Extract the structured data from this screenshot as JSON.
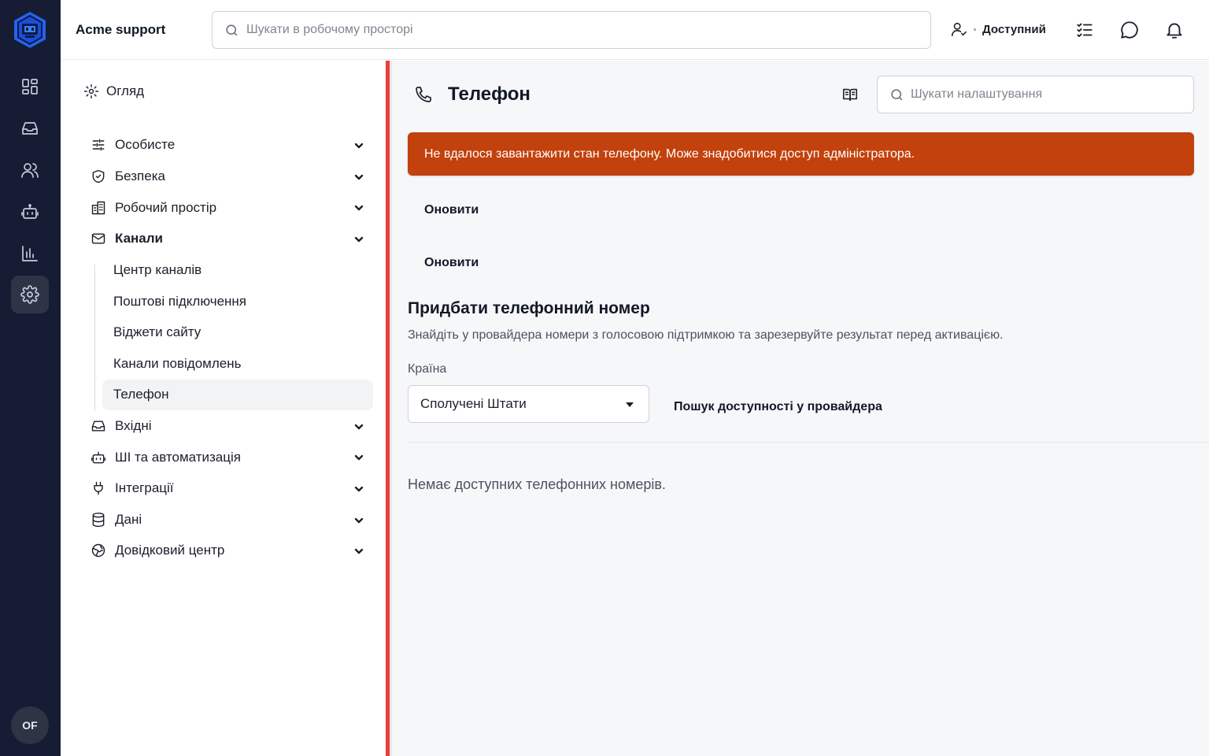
{
  "app": {
    "brand": "Acme support",
    "user_initials": "OF",
    "accent_color": "#2563eb",
    "alert_color": "#c2410c",
    "highlight_color": "#ef3b3b"
  },
  "topbar": {
    "search_placeholder": "Шукати в робочому просторі",
    "status_label": "Доступний",
    "icons": [
      "user-icon",
      "checklist-icon",
      "chat-icon",
      "bell-icon"
    ]
  },
  "rail": {
    "icons": [
      "dashboard-icon",
      "inbox-icon",
      "users-icon",
      "bot-icon",
      "analytics-icon",
      "settings-icon"
    ],
    "active": "settings-icon"
  },
  "nav": {
    "overview": "Огляд",
    "groups": [
      {
        "label": "Особисте",
        "icon": "sliders-icon"
      },
      {
        "label": "Безпека",
        "icon": "shield-icon"
      },
      {
        "label": "Робочий простір",
        "icon": "building-icon"
      },
      {
        "label": "Канали",
        "icon": "mail-icon"
      },
      {
        "label": "Вхідні",
        "icon": "inbox-icon"
      },
      {
        "label": "ШІ та автоматизація",
        "icon": "bot-icon"
      },
      {
        "label": "Інтеграції",
        "icon": "plug-icon"
      },
      {
        "label": "Дані",
        "icon": "database-icon"
      },
      {
        "label": "Довідковий центр",
        "icon": "globe-icon"
      }
    ],
    "channels_sub": [
      "Центр каналів",
      "Поштові підключення",
      "Віджети сайту",
      "Канали повідомлень",
      "Телефон"
    ],
    "active_sub": "Телефон"
  },
  "main": {
    "title": "Телефон",
    "settings_search_placeholder": "Шукати налаштування",
    "alert": "Не вдалося завантажити стан телефону. Може знадобитися доступ адміністратора.",
    "refresh_1": "Оновити",
    "refresh_2": "Оновити",
    "section_title": "Придбати телефонний номер",
    "section_desc": "Знайдіть у провайдера номери з голосовою підтримкою та зарезервуйте результат перед активацією.",
    "country_label": "Країна",
    "country_value": "Сполучені Штати",
    "search_provider": "Пошук доступності у провайдера",
    "empty": "Немає доступних телефонних номерів."
  }
}
